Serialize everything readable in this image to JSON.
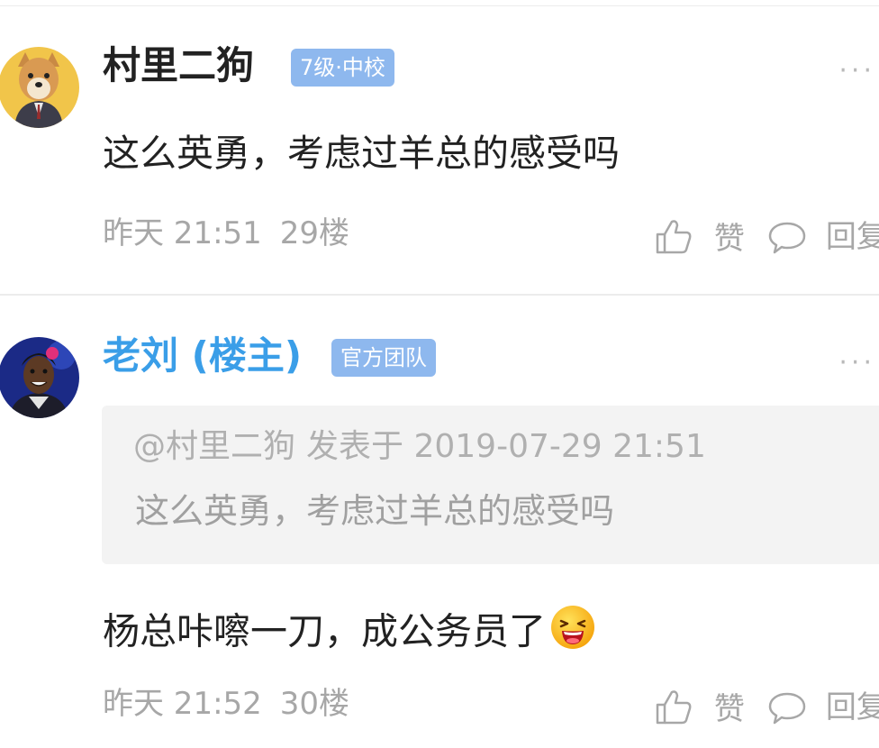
{
  "comments": [
    {
      "author": "村里二狗",
      "badge": "7级·中校",
      "more": "···",
      "content": "这么英勇，考虑过羊总的感受吗",
      "time": "昨天 21:51",
      "floor": "29楼",
      "like_label": "赞",
      "reply_label": "回复"
    },
    {
      "author": "老刘 (楼主)",
      "badge": "官方团队",
      "more": "···",
      "quote": {
        "mention": "@村里二狗",
        "posted_at": "发表于 2019-07-29 21:51",
        "text": "这么英勇，考虑过羊总的感受吗"
      },
      "content": "杨总咔嚓一刀，成公务员了",
      "emoji": "laughing-emoji",
      "time": "昨天 21:52",
      "floor": "30楼",
      "like_label": "赞",
      "reply_label": "回复"
    }
  ],
  "colors": {
    "op_name": "#3a9ee8",
    "badge_bg": "#8eb8ee",
    "meta_text": "#a7a7a7"
  }
}
